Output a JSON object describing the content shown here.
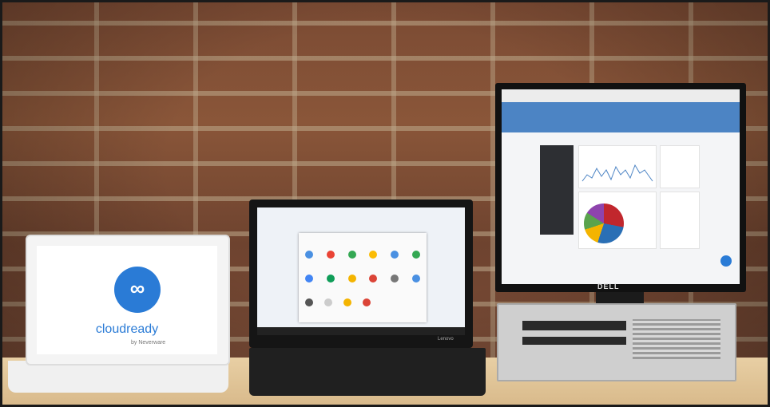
{
  "photo": {
    "left_laptop": {
      "brand_text": "cloudready",
      "byline": "by Neverware"
    },
    "middle_laptop": {
      "brand_text": "Lenovo"
    },
    "monitor": {
      "brand_text": "DELL"
    }
  }
}
